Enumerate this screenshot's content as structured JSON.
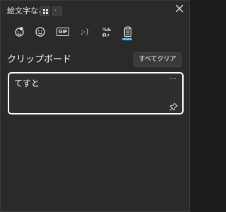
{
  "window": {
    "title": "絵文字など",
    "shortcut_keys": [
      "windows-logo-key",
      "period-key"
    ],
    "shortcut_period_glyph": "."
  },
  "tabs": [
    {
      "name": "emoji-heart",
      "icon": "heart-face-icon"
    },
    {
      "name": "emoji",
      "icon": "smiley-icon"
    },
    {
      "name": "gif",
      "icon": "gif-icon",
      "label": "GIF"
    },
    {
      "name": "kaomoji",
      "icon": "kaomoji-icon",
      "label": ";-)"
    },
    {
      "name": "symbols",
      "icon": "symbols-icon",
      "label": "%&\nΩ+"
    },
    {
      "name": "clipboard",
      "icon": "clipboard-icon",
      "selected": true
    }
  ],
  "clipboard": {
    "title": "クリップボード",
    "clear_all_label": "すべてクリア",
    "items": [
      {
        "text": "てすと",
        "more_label": "···"
      }
    ]
  },
  "colors": {
    "panel_bg": "#2b2a29",
    "accent": "#4cc2ff",
    "text": "#ffffff"
  }
}
